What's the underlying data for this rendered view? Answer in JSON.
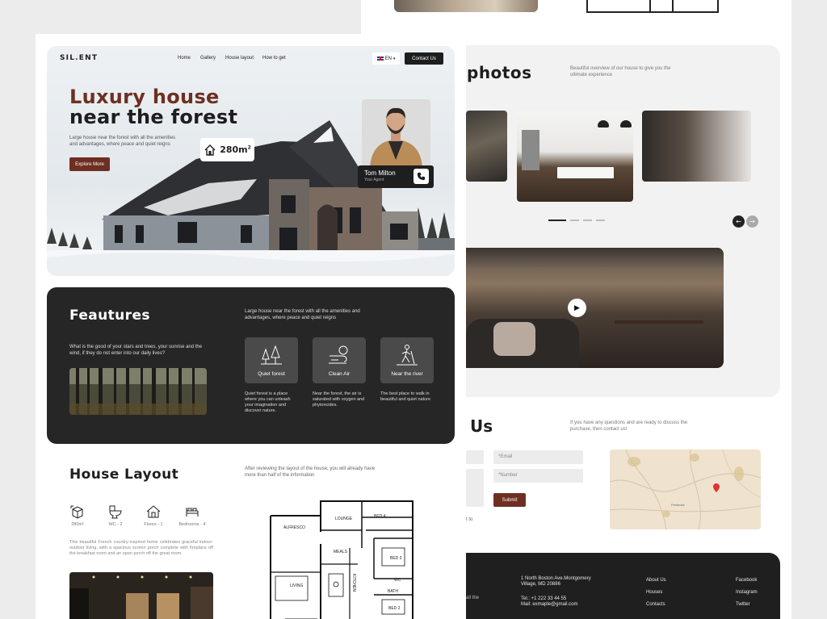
{
  "back": {
    "gallery": {
      "title": "photos",
      "description": "Beautiful overview of our house to give you the ultimate experience"
    },
    "contact": {
      "title": "Us",
      "description": "If you have any questions and are ready to discuss the purchase, then contact us!",
      "email_placeholder": "*Email",
      "number_placeholder": "*Number",
      "submit_label": "Submit",
      "partial_text": "t to"
    },
    "map": {
      "place_label": "Frederick"
    },
    "footer": {
      "partial_text": "all the",
      "address_line1": "1 North Boston Ave.Montgomery",
      "address_line2": "Village, MD 20886",
      "phone": "Tel.: +1 222 33 44 55",
      "mail": "Mail: exmaple@gmail.com",
      "links": [
        "About Us",
        "Houses",
        "Contacts"
      ],
      "social": [
        "Facebook",
        "Instagram",
        "Twitter"
      ]
    }
  },
  "header": {
    "logo": "SIL.ENT",
    "nav": [
      "Home",
      "Gallery",
      "House layout",
      "How to get"
    ],
    "language": "EN",
    "contact_button": "Contact Us"
  },
  "hero": {
    "title_line1": "Luxury house",
    "title_line2": "near the forest",
    "description": "Large house near the forest with all the amenities and advantages, where peace and quiet reigns",
    "cta": "Explore More",
    "area": "280m",
    "area_sup": "2",
    "agent_name": "Tom Milton",
    "agent_role": "Your Agent"
  },
  "features": {
    "title": "Feautures",
    "description": "Large house near the forest with all the amenities and advantages, where peace and quiet reigns",
    "question": "What is the good of your stars and trees, your sunrise and the wind, if they do not enter into our daily lives?",
    "cards": [
      {
        "label": "Quiet forest",
        "icon": "trees-icon",
        "text": "Quiet forest is a place where you can unleash your imagination and discover nature."
      },
      {
        "label": "Clean Air",
        "icon": "wind-icon",
        "text": "Near the forest, the air is saturated with oxygen and phytoncides."
      },
      {
        "label": "Near the river",
        "icon": "walker-icon",
        "text": "The best place to walk in beautiful and quiet nature"
      }
    ]
  },
  "layout": {
    "title": "House Layout",
    "description": "After reviewing the layout of the house, you will already have more than half of the information",
    "specs": [
      {
        "label": "280m²",
        "icon": "area-cube-icon"
      },
      {
        "label": "WC - 2",
        "icon": "toilet-icon"
      },
      {
        "label": "Floors - 1",
        "icon": "house-icon"
      },
      {
        "label": "Bedrooms - 4",
        "icon": "bed-icon"
      }
    ],
    "paragraph": "This beautiful French country-inspired home celebrates graceful indoor-outdoor living, with a spacious screen porch complete with fireplace off the breakfast room and an open porch off the great room.",
    "rooms": {
      "alfresco": "ALFRESCO",
      "lounge": "LOUNGE",
      "bed4": "BED 4",
      "meals": "MEALS",
      "bed3": "BED 3",
      "living": "LIVING",
      "kitchen": "KITCHEN",
      "wc": "WC",
      "bath": "BATH",
      "bed2": "BED 2"
    }
  },
  "colors": {
    "accent": "#6e2f22",
    "dark": "#1e1e1e",
    "panel": "#262626"
  }
}
